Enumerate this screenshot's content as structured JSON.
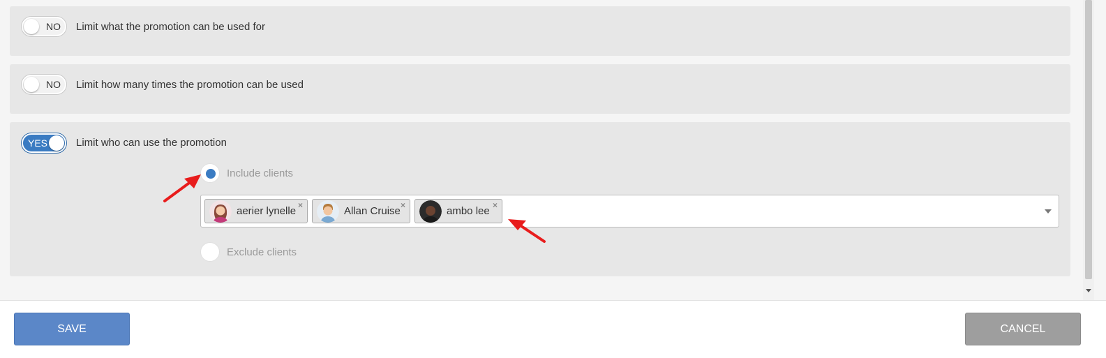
{
  "sections": [
    {
      "toggle": "NO",
      "title": "Limit what the promotion can be used for"
    },
    {
      "toggle": "NO",
      "title": "Limit how many times the promotion can be used"
    },
    {
      "toggle": "YES",
      "title": "Limit who can use the promotion"
    }
  ],
  "client_filter": {
    "include_label": "Include clients",
    "exclude_label": "Exclude clients",
    "selected": "include",
    "chips": [
      {
        "name": "aerier lynelle",
        "remove": "×"
      },
      {
        "name": "Allan Cruise",
        "remove": "×"
      },
      {
        "name": "ambo lee",
        "remove": "×"
      }
    ]
  },
  "footer": {
    "save_label": "SAVE",
    "cancel_label": "CANCEL"
  },
  "colors": {
    "accent": "#3a7bc2",
    "save_button": "#5b87c8",
    "cancel_button": "#9e9e9e",
    "panel": "#e7e7e7",
    "annotation_arrow": "#e81c1c"
  }
}
